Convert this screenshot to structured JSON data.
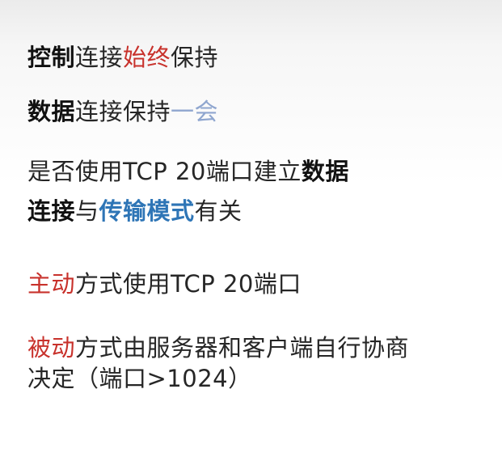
{
  "lines": [
    {
      "segments": [
        {
          "text": "控制",
          "style": "bold"
        },
        {
          "text": "连接",
          "style": "normal"
        },
        {
          "text": "始终",
          "style": "red"
        },
        {
          "text": "保持",
          "style": "normal"
        }
      ]
    },
    {
      "segments": [
        {
          "text": "数据",
          "style": "bold"
        },
        {
          "text": "连接保持",
          "style": "normal"
        },
        {
          "text": "一会",
          "style": "pale-blue"
        }
      ]
    },
    {
      "segments": [
        {
          "text": "是否使用TCP 20端口建立",
          "style": "normal"
        },
        {
          "text": "数据",
          "style": "bold"
        }
      ]
    },
    {
      "segments": [
        {
          "text": "连接",
          "style": "bold"
        },
        {
          "text": "与",
          "style": "normal"
        },
        {
          "text": "传输模式",
          "style": "blue-bold"
        },
        {
          "text": "有关",
          "style": "normal"
        }
      ]
    },
    {
      "segments": [
        {
          "text": "主动",
          "style": "red"
        },
        {
          "text": "方式使用TCP 20端口",
          "style": "normal"
        }
      ]
    },
    {
      "segments": [
        {
          "text": "被动",
          "style": "red"
        },
        {
          "text": "方式由服务器和客户端自行协商",
          "style": "normal"
        }
      ]
    },
    {
      "segments": [
        {
          "text": "决定（端口>1024）",
          "style": "normal"
        }
      ]
    }
  ],
  "colors": {
    "text": "#262626",
    "bold": "#111111",
    "red": "#c8322c",
    "blue": "#2e75b6",
    "pale_blue": "#8fa6cf"
  }
}
